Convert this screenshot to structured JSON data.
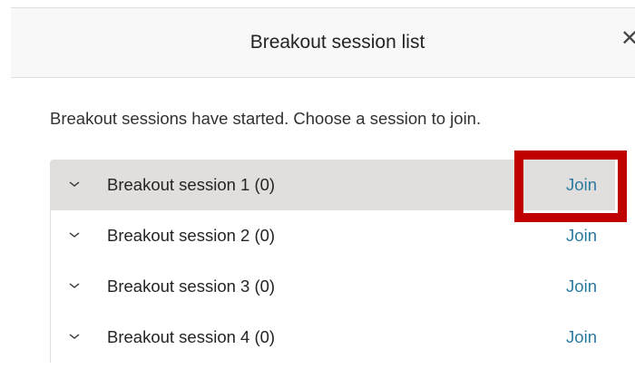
{
  "dialog": {
    "title": "Breakout session list",
    "close_icon": "close-icon",
    "instructions": "Breakout sessions have started. Choose a session to join."
  },
  "sessions": [
    {
      "name": "Breakout session 1 (0)",
      "join_label": "Join",
      "highlighted": true
    },
    {
      "name": "Breakout session 2 (0)",
      "join_label": "Join",
      "highlighted": false
    },
    {
      "name": "Breakout session 3 (0)",
      "join_label": "Join",
      "highlighted": false
    },
    {
      "name": "Breakout session 4 (0)",
      "join_label": "Join",
      "highlighted": false
    }
  ],
  "colors": {
    "link": "#2b7aa0",
    "highlight_border": "#c00000",
    "active_row": "#e1dfdd",
    "header_bg": "#f8f8f8"
  }
}
